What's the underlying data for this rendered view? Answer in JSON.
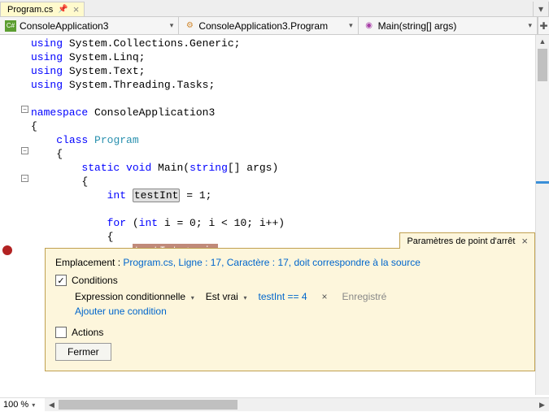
{
  "tab": {
    "label": "Program.cs"
  },
  "nav": {
    "project": "ConsoleApplication3",
    "class": "ConsoleApplication3.Program",
    "method": "Main(string[] args)"
  },
  "code": {
    "l1_u": "using",
    "l1_r": " System.Collections.Generic;",
    "l2_u": "using",
    "l2_r": " System.Linq;",
    "l3_u": "using",
    "l3_r": " System.Text;",
    "l4_u": "using",
    "l4_r": " System.Threading.Tasks;",
    "ns": "namespace",
    "ns_r": " ConsoleApplication3",
    "ob": "{",
    "cls": "class",
    "cls_n": " Program",
    "ob2": "    {",
    "st": "static",
    "vd": " void",
    "mn": " Main(",
    "sa": "string",
    "mn2": "[] args)",
    "ob3": "        {",
    "int1": "int",
    "ti": "testInt",
    "eq1": " = 1;",
    "for1": "for",
    "for2": " (",
    "int2": "int",
    "for3": " i = 0; i < 10; i++)",
    "ob4": "            {",
    "bline": "testInt += i;"
  },
  "panel": {
    "title": "Paramètres de point d'arrêt",
    "loc_label": "Emplacement : ",
    "loc_link": "Program.cs, Ligne : 17, Caractère : 17, doit correspondre à la source",
    "conditions": "Conditions",
    "expr_label": "Expression conditionnelle",
    "true_label": "Est vrai",
    "expr_value": "testInt == 4",
    "saved": "Enregistré",
    "add_cond": "Ajouter une condition",
    "actions": "Actions",
    "close": "Fermer"
  },
  "zoom": "100 %"
}
